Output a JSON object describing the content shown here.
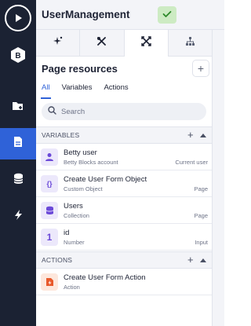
{
  "header": {
    "title": "UserManagement",
    "status_icon": "check-icon",
    "status_color": "#cdebc3"
  },
  "rail": {
    "logo_text": "B",
    "items": [
      {
        "icon": "play-icon"
      },
      {
        "icon": "betty-logo"
      },
      {
        "icon": "add-folder-icon"
      },
      {
        "icon": "page-icon",
        "active": true
      },
      {
        "icon": "database-icon"
      },
      {
        "icon": "lightning-icon"
      }
    ],
    "active_color": "#2f62d8"
  },
  "tabs": [
    {
      "icon": "sparkle-icon"
    },
    {
      "icon": "tools-icon"
    },
    {
      "icon": "crossed-arrows-icon",
      "active": true
    },
    {
      "icon": "sitemap-icon"
    }
  ],
  "panel": {
    "title": "Page resources",
    "add_label": "+",
    "subtabs": [
      "All",
      "Variables",
      "Actions"
    ],
    "active_subtab": "All",
    "search_placeholder": "Search"
  },
  "sections": {
    "variables": {
      "label": "VARIABLES",
      "plus": "+",
      "rows": [
        {
          "title": "Betty user",
          "subtitle": "Betty Blocks account",
          "scope": "Current user",
          "icon": "user-icon"
        },
        {
          "title": "Create User Form Object",
          "subtitle": "Custom Object",
          "scope": "Page",
          "icon": "braces-icon",
          "icon_text": "{}"
        },
        {
          "title": "Users",
          "subtitle": "Collection",
          "scope": "Page",
          "icon": "database-icon"
        },
        {
          "title": "id",
          "subtitle": "Number",
          "scope": "Input",
          "icon": "number-icon",
          "icon_text": "1"
        }
      ]
    },
    "actions": {
      "label": "ACTIONS",
      "plus": "+",
      "rows": [
        {
          "title": "Create User Form Action",
          "subtitle": "Action",
          "scope": "",
          "icon": "action-icon"
        }
      ]
    }
  }
}
